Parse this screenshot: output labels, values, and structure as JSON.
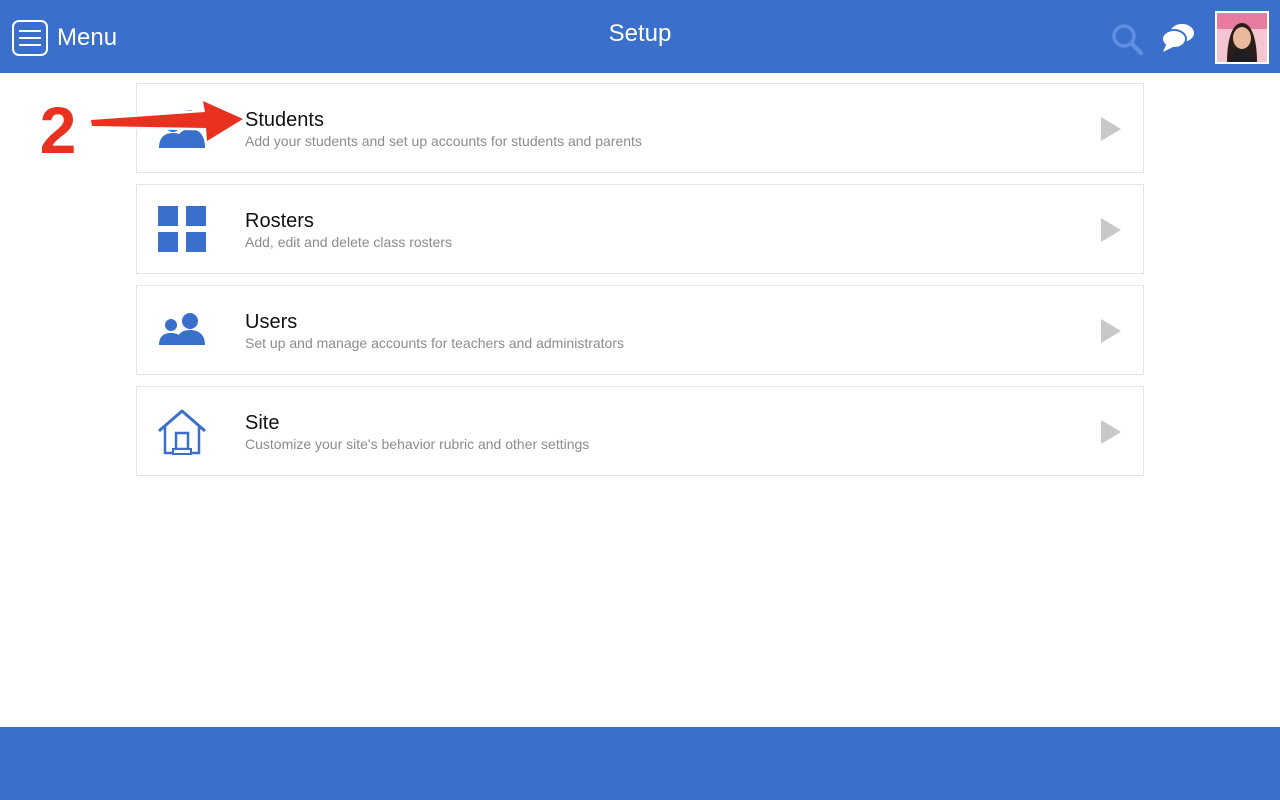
{
  "header": {
    "menu_label": "Menu",
    "title": "Setup",
    "icons": {
      "menu": "hamburger-icon",
      "search": "search-icon",
      "messages": "chat-bubbles-icon",
      "avatar": "user-avatar"
    }
  },
  "items": [
    {
      "title": "Students",
      "description": "Add your students and set up accounts for students and parents",
      "icon": "students-icon"
    },
    {
      "title": "Rosters",
      "description": "Add, edit and delete class rosters",
      "icon": "grid-icon"
    },
    {
      "title": "Users",
      "description": "Set up and manage accounts for teachers and administrators",
      "icon": "users-icon"
    },
    {
      "title": "Site",
      "description": "Customize your site's behavior rubric and other settings",
      "icon": "house-icon"
    }
  ],
  "annotation": {
    "step": "2"
  },
  "colors": {
    "brand": "#3a6fcc",
    "annotation": "#e8321f",
    "chevron": "#c8c8c8",
    "description": "#8c8c8c"
  }
}
